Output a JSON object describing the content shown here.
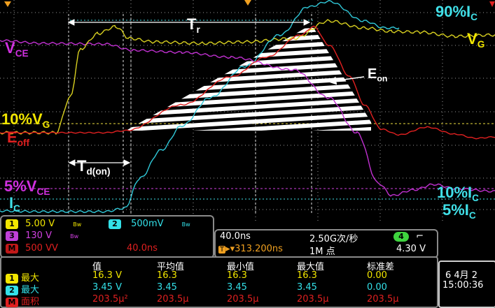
{
  "annotations": {
    "tr": "T",
    "tr_sub": "r",
    "vce": "V",
    "vce_sub": "CE",
    "ic90": "90%I",
    "ic90_sub": "C",
    "vg": "V",
    "vg_sub": "G",
    "eon": "E",
    "eon_sub": "on",
    "vg10": "10%V",
    "vg10_sub": "G",
    "eoff": "E",
    "eoff_sub": "off",
    "tdon": "T",
    "tdon_sub": "d(on)",
    "vce5": "5%V",
    "vce5_sub": "CE",
    "ic": "I",
    "ic_sub": "C",
    "ic10": "10%I",
    "ic10_sub": "C",
    "ic5": "5%I",
    "ic5_sub": "C"
  },
  "channels": {
    "ch1": {
      "num": "1",
      "scale": "5.00 V",
      "color": "#f2e600"
    },
    "ch2": {
      "num": "2",
      "scale": "500mV",
      "color": "#33e0e8"
    },
    "ch3": {
      "num": "3",
      "scale": "130 V",
      "color": "#d040e0"
    },
    "math": {
      "num": "M",
      "scale": "500 VV",
      "time": "40.0ns",
      "color": "#e02020"
    },
    "bw_icon_label": "Bw"
  },
  "timebase": {
    "horizontal": "40.0ns",
    "sample_rate": "2.50G次/秒",
    "delay": "▸▾313.200ns",
    "record": "1M 点",
    "trigger_ch": "4",
    "trigger_level": "4.30 V"
  },
  "measure": {
    "headers": [
      "值",
      "平均值",
      "最小值",
      "最大值",
      "标准差"
    ],
    "rows": [
      {
        "ch": "1",
        "name": "最大",
        "values": [
          "16.3 V",
          "16.3",
          "16.3",
          "16.3",
          "0.00"
        ],
        "color": "#f2e600"
      },
      {
        "ch": "2",
        "name": "最大",
        "values": [
          "3.45 V",
          "3.45",
          "3.45",
          "3.45",
          "0.00"
        ],
        "color": "#33e0e8"
      },
      {
        "ch": "M",
        "name": "面积",
        "values": [
          "203.5μ²",
          "203.5μ",
          "203.5μ",
          "203.5μ",
          "203.5μ"
        ],
        "color": "#e02020"
      }
    ]
  },
  "datetime": {
    "date": "6 4月 2",
    "time": "15:00:36"
  },
  "colors": {
    "grid": "#9a9a9a",
    "vce": "#c030d0",
    "ic": "#30c8d8",
    "vg": "#d8d020",
    "math": "#e02020",
    "ref": "#f0e040"
  }
}
